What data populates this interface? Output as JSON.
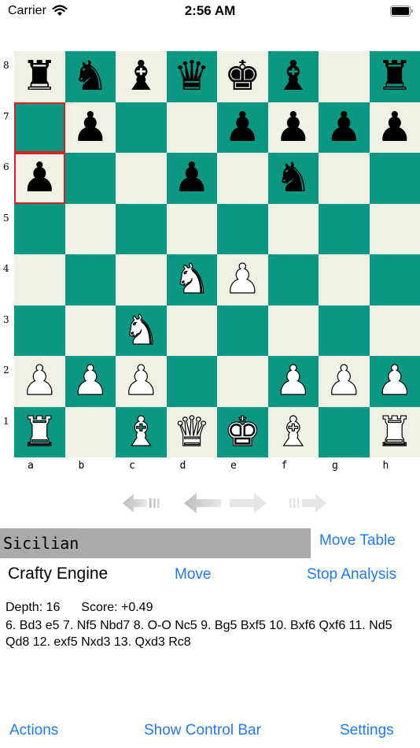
{
  "status_bar": {
    "carrier": "Carrier",
    "time": "2:56 AM"
  },
  "board": {
    "light_color": "#f0f0e4",
    "dark_color": "#0b9782",
    "highlight_color": "#d32323",
    "ranks": [
      "8",
      "7",
      "6",
      "5",
      "4",
      "3",
      "2",
      "1"
    ],
    "files": [
      "a",
      "b",
      "c",
      "d",
      "e",
      "f",
      "g",
      "h"
    ],
    "highlighted_squares": [
      "a7",
      "a6"
    ],
    "position": [
      [
        "r",
        "n",
        "b",
        "q",
        "k",
        "b",
        "",
        "r"
      ],
      [
        "",
        "p",
        "",
        "",
        "p",
        "p",
        "p",
        "p"
      ],
      [
        "p",
        "",
        "",
        "p",
        "",
        "n",
        "",
        ""
      ],
      [
        "",
        "",
        "",
        "",
        "",
        "",
        "",
        ""
      ],
      [
        "",
        "",
        "",
        "N",
        "P",
        "",
        "",
        ""
      ],
      [
        "",
        "",
        "N",
        "",
        "",
        "",
        "",
        ""
      ],
      [
        "P",
        "P",
        "P",
        "",
        "",
        "P",
        "P",
        "P"
      ],
      [
        "R",
        "",
        "B",
        "Q",
        "K",
        "B",
        "",
        "R"
      ]
    ]
  },
  "nav_buttons": [
    "rewind-to-start",
    "step-back",
    "step-forward",
    "forward-to-end"
  ],
  "opening": {
    "name": "Sicilian",
    "move_table_label": "Move Table"
  },
  "engine": {
    "name": "Crafty Engine",
    "move_label": "Move",
    "stop_analysis_label": "Stop Analysis",
    "depth_text": "Depth: 16",
    "score_text": "Score: +0.49",
    "pv": "6. Bd3 e5 7. Nf5 Nbd7 8. O-O Nc5 9. Bg5 Bxf5 10. Bxf6 Qxf6 11. Nd5 Qd8 12. exf5 Nxd3 13. Qxd3 Rc8"
  },
  "toolbar": {
    "actions_label": "Actions",
    "control_bar_label": "Show Control Bar",
    "settings_label": "Settings"
  },
  "colors": {
    "accent": "#1f7af5",
    "opening_bar": "#aaaaaa"
  }
}
